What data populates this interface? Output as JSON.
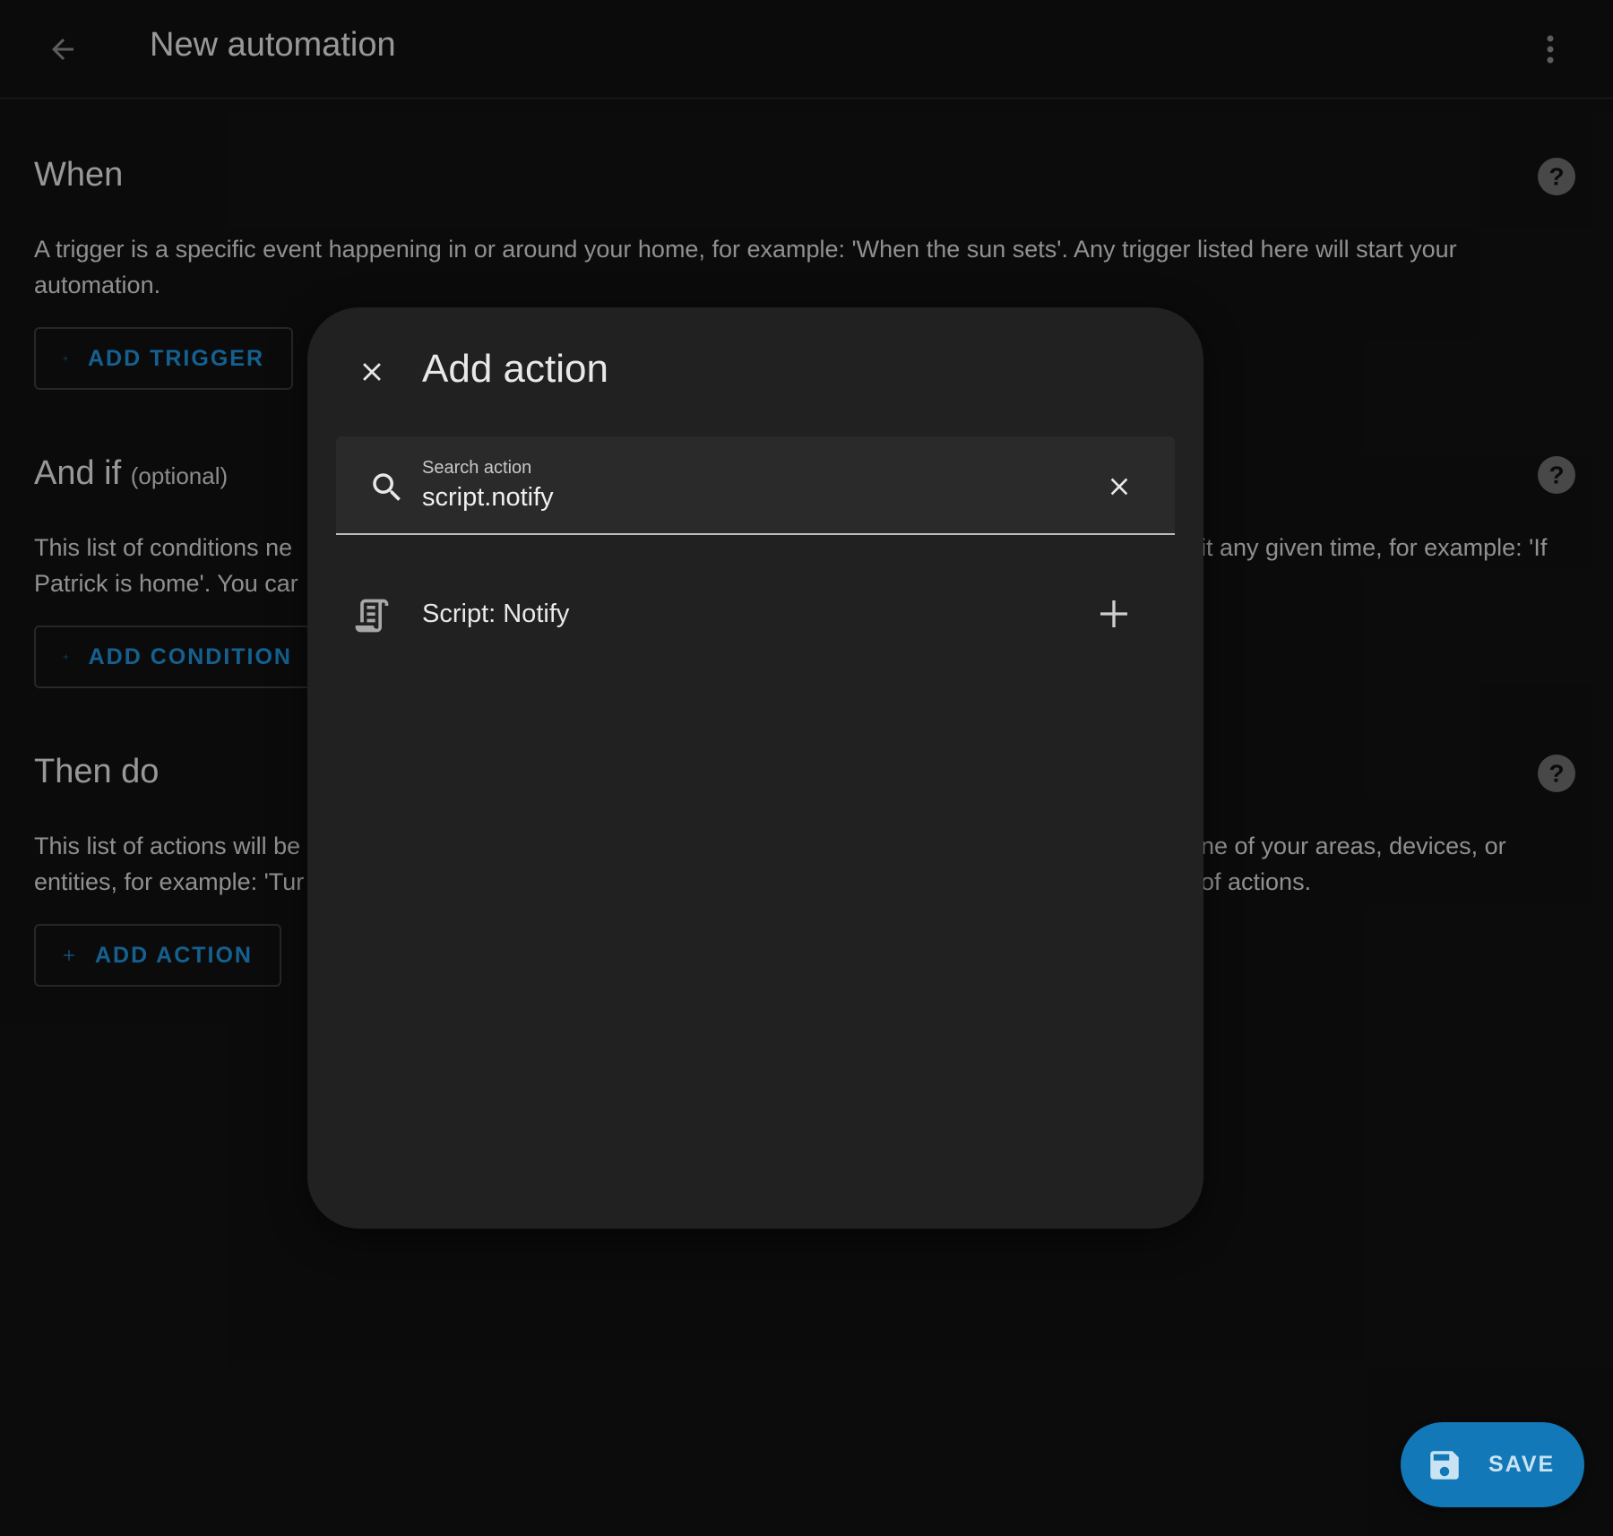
{
  "header": {
    "title": "New automation",
    "back_icon": "arrow-left-icon",
    "menu_icon": "dots-vertical-icon"
  },
  "sections": {
    "triggers": {
      "title": "When",
      "description": "A trigger is a specific event happening in or around your home, for example: 'When the sun sets'. Any trigger listed here will start your automation.",
      "button_label": "ADD TRIGGER"
    },
    "conditions": {
      "title": "And if",
      "title_suffix": "(optional)",
      "description_left_line1": "This list of conditions ne",
      "description_left_line2": "Patrick is home'. You car",
      "description_right_line1": "it any given time, for example: 'If",
      "button_label": "ADD CONDITION"
    },
    "actions": {
      "title": "Then do",
      "description_left_line1": "This list of actions will be",
      "description_left_line2": "entities, for example: 'Tur",
      "description_right_line1": "ne of your areas, devices, or",
      "description_right_line2": "of actions.",
      "button_label": "ADD ACTION"
    }
  },
  "dialog": {
    "title": "Add action",
    "search": {
      "label": "Search action",
      "value": "script.notify"
    },
    "results": [
      {
        "label": "Script: Notify",
        "icon": "script-text-icon"
      }
    ]
  },
  "fab": {
    "label": "SAVE",
    "icon": "content-save-icon"
  },
  "colors": {
    "background": "#111111",
    "dialog_background": "#212121",
    "accent": "#1e90d6",
    "fab_background": "#1378b8"
  }
}
